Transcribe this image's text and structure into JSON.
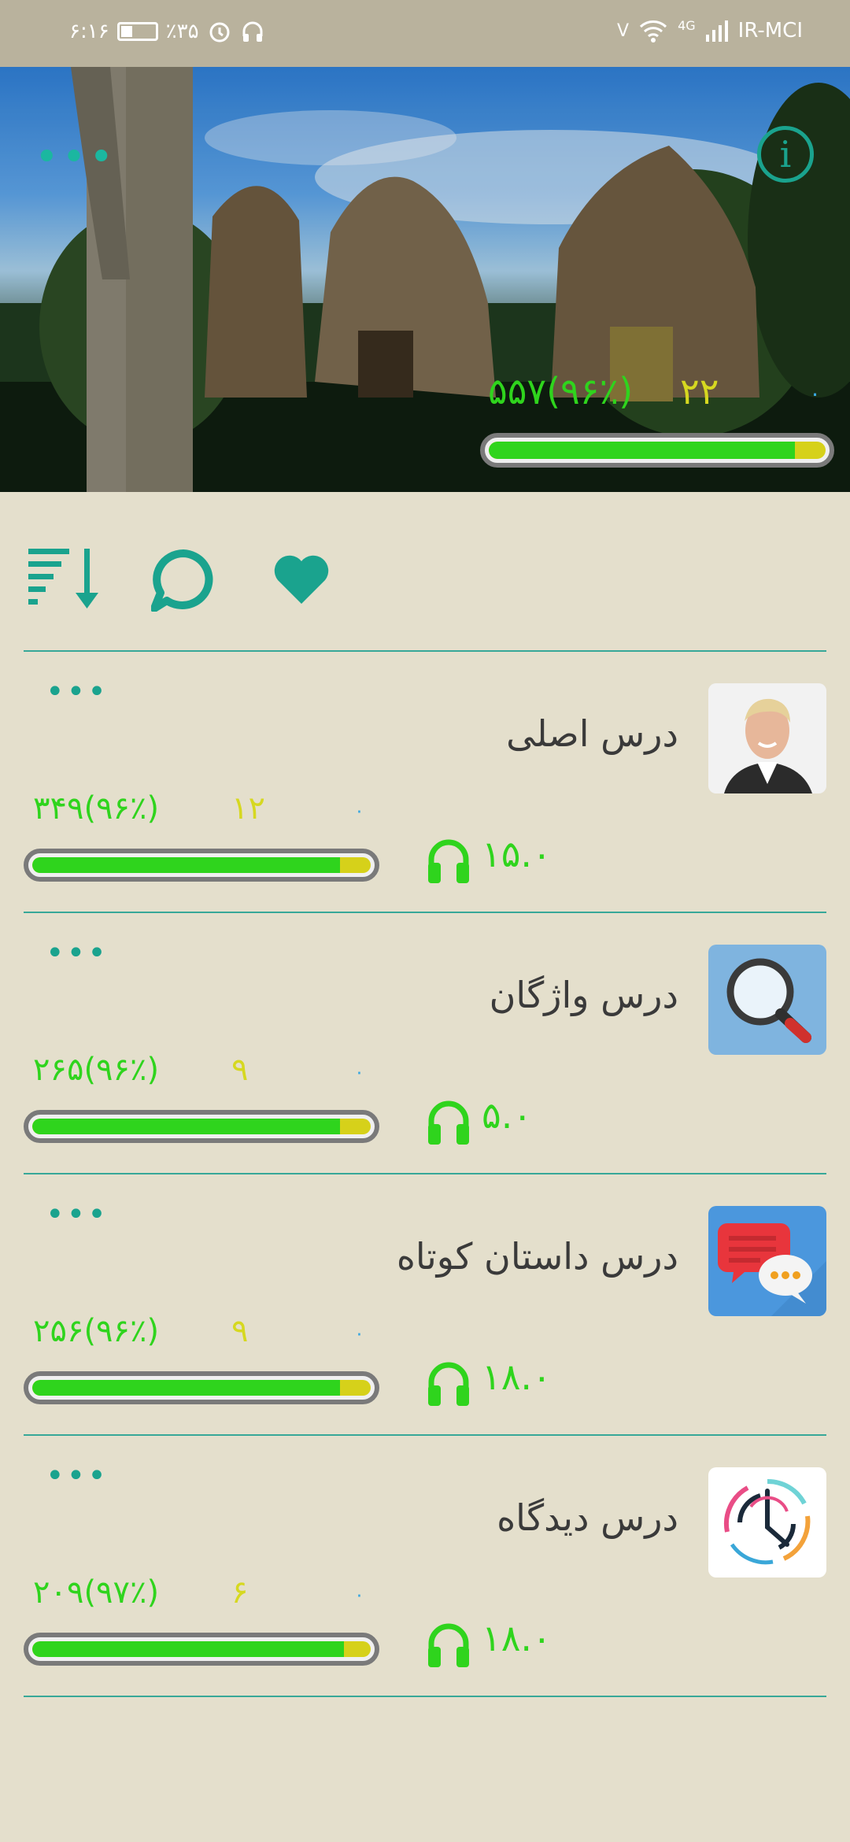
{
  "status_bar": {
    "time": "۶:۱۶",
    "battery": "٪۳۵",
    "network_letter": "V",
    "network_type": "4G",
    "carrier": "IR-MCI"
  },
  "header": {
    "main_stat": "۵۵۷(۹۶٪)",
    "mid_stat": "۲۲",
    "zero_stat": "۰",
    "progress": 0.91,
    "colors": {
      "fill": "#2fd41d",
      "remainder": "#d6d11a",
      "accent": "#1aa38e"
    }
  },
  "toolbar": {
    "icons": [
      "sort-descending-icon",
      "comment-icon",
      "heart-icon"
    ]
  },
  "lessons": [
    {
      "title": "درس اصلی",
      "main_stat": "۳۴۹(۹۶٪)",
      "mid_stat": "۱۲",
      "zero_stat": "۰",
      "duration": "۱۵.۰",
      "progress": 0.91,
      "thumbnail": "portrait-photo"
    },
    {
      "title": "درس واژگان",
      "main_stat": "۲۶۵(۹۶٪)",
      "mid_stat": "۹",
      "zero_stat": "۰",
      "duration": "۵.۰",
      "progress": 0.91,
      "thumbnail": "magnifier-icon"
    },
    {
      "title": "درس داستان کوتاه",
      "main_stat": "۲۵۶(۹۶٪)",
      "mid_stat": "۹",
      "zero_stat": "۰",
      "duration": "۱۸.۰",
      "progress": 0.91,
      "thumbnail": "chat-bubbles-icon"
    },
    {
      "title": "درس دیدگاه",
      "main_stat": "۲۰۹(۹۷٪)",
      "mid_stat": "۶",
      "zero_stat": "۰",
      "duration": "۱۸.۰",
      "progress": 0.92,
      "thumbnail": "clock-logo"
    }
  ]
}
